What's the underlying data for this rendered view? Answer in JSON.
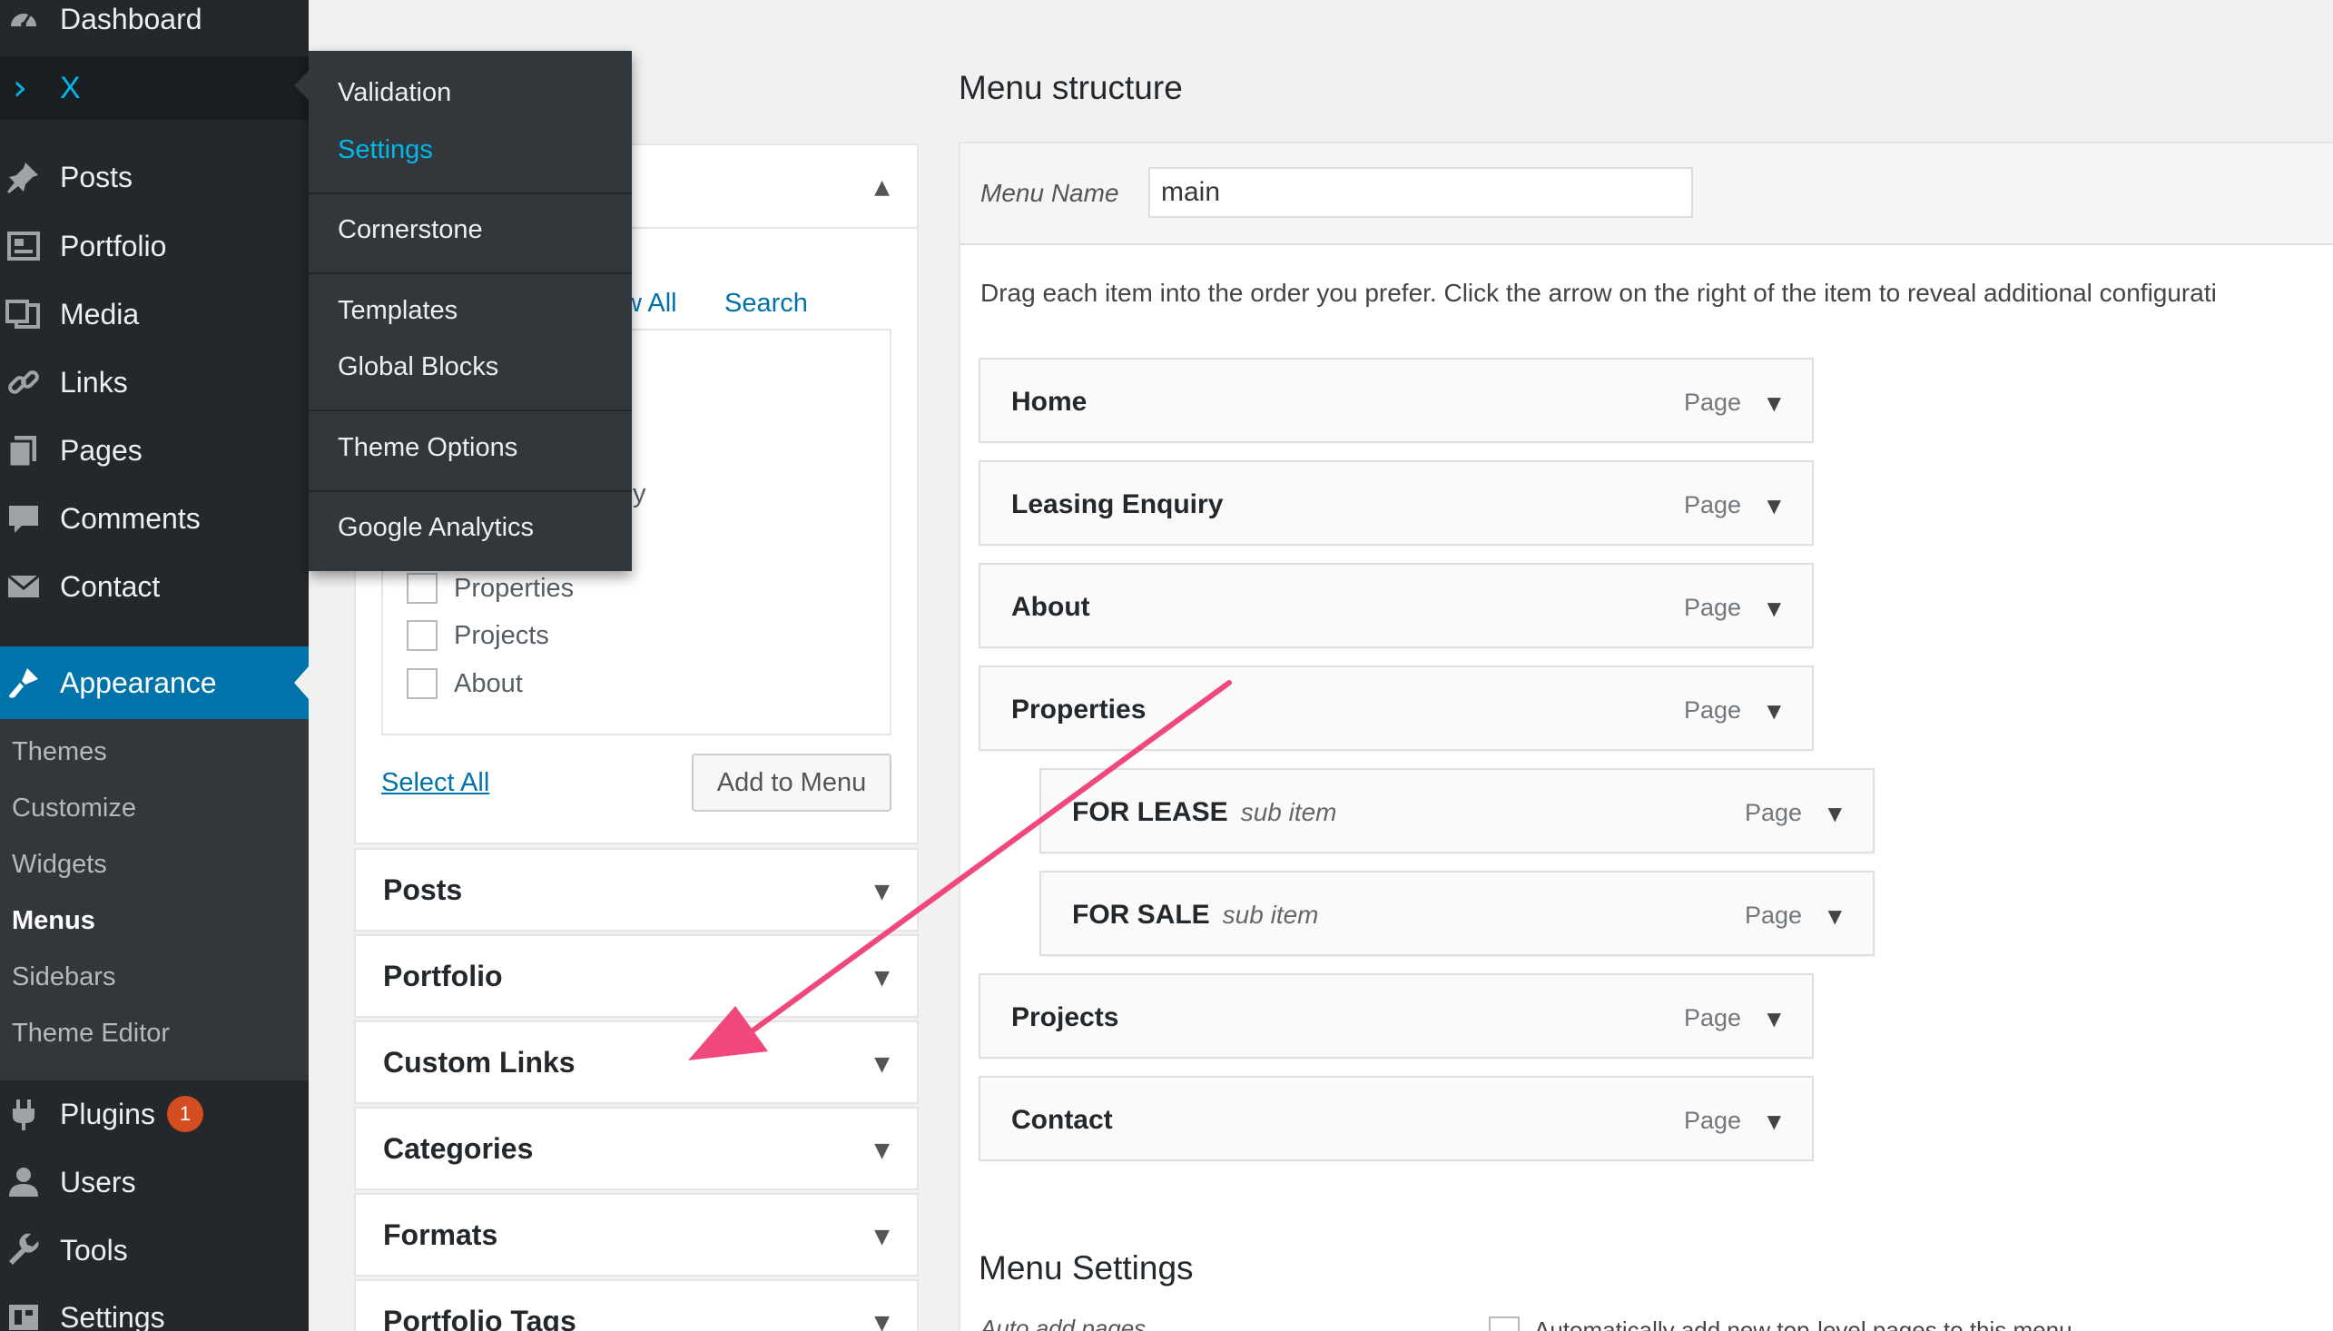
{
  "sidebar": {
    "dashboard": "Dashboard",
    "x": "X",
    "posts": "Posts",
    "portfolio": "Portfolio",
    "media": "Media",
    "links": "Links",
    "pages": "Pages",
    "comments": "Comments",
    "contact": "Contact",
    "appearance": "Appearance",
    "submenu": [
      "Themes",
      "Customize",
      "Widgets",
      "Menus",
      "Sidebars",
      "Theme Editor"
    ],
    "plugins": "Plugins",
    "plugins_badge": "1",
    "users": "Users",
    "tools": "Tools",
    "settings": "Settings"
  },
  "flyout": {
    "items": [
      "Validation",
      "Settings",
      "Cornerstone",
      "Templates",
      "Global Blocks",
      "Theme Options",
      "Google Analytics"
    ]
  },
  "left_panel": {
    "tab_view_all": "w All",
    "tab_search": "Search",
    "partial_text": "y",
    "checkbox_items": [
      "Properties",
      "Projects",
      "About"
    ],
    "select_all": "Select All",
    "add_to_menu": "Add to Menu",
    "sections": [
      "Posts",
      "Portfolio",
      "Custom Links",
      "Categories",
      "Formats",
      "Portfolio Tags"
    ]
  },
  "menu_structure": {
    "heading": "Menu structure",
    "menu_name_label": "Menu Name",
    "menu_name_value": "main",
    "instructions": "Drag each item into the order you prefer. Click the arrow on the right of the item to reveal additional configurati",
    "items": [
      {
        "title": "Home",
        "sub": "",
        "type": "Page"
      },
      {
        "title": "Leasing Enquiry",
        "sub": "",
        "type": "Page"
      },
      {
        "title": "About",
        "sub": "",
        "type": "Page"
      },
      {
        "title": "Properties",
        "sub": "",
        "type": "Page"
      },
      {
        "title": "FOR LEASE",
        "sub": "sub item",
        "type": "Page"
      },
      {
        "title": "FOR SALE",
        "sub": "sub item",
        "type": "Page"
      },
      {
        "title": "Projects",
        "sub": "",
        "type": "Page"
      },
      {
        "title": "Contact",
        "sub": "",
        "type": "Page"
      }
    ],
    "settings_heading": "Menu Settings",
    "auto_add_label": "Auto add pages",
    "auto_add_text": "Automatically add new top-level pages to this menu"
  },
  "colors": {
    "sidebar_bg": "#23282d",
    "accent": "#0073aa",
    "highlight": "#00b9eb",
    "arrow": "#f0487a",
    "badge": "#d54e21"
  },
  "icons": {
    "dashboard": "gauge-icon",
    "x": "chevron-right-icon",
    "posts": "pin-icon",
    "portfolio": "portfolio-icon",
    "media": "media-icon",
    "links": "link-icon",
    "pages": "pages-icon",
    "comments": "comment-icon",
    "contact": "envelope-icon",
    "appearance": "brush-icon",
    "plugins": "plug-icon",
    "users": "user-icon",
    "tools": "wrench-icon",
    "settings": "settings-icon"
  }
}
